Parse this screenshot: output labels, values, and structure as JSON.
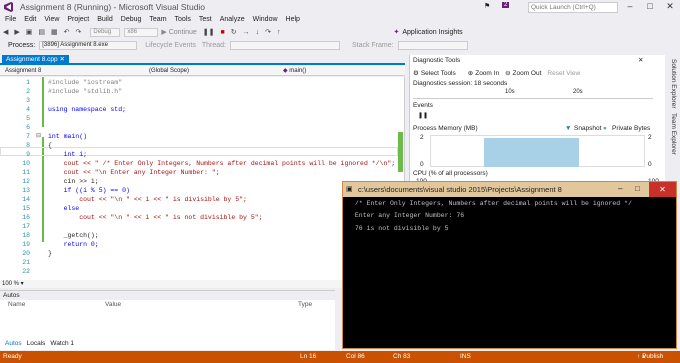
{
  "window": {
    "title": "Assignment 8 (Running) - Microsoft Visual Studio",
    "notif_count": "2",
    "quick_launch": "Quick Launch (Ctrl+Q)"
  },
  "menu": [
    "File",
    "Edit",
    "View",
    "Project",
    "Build",
    "Debug",
    "Team",
    "Tools",
    "Test",
    "Analyze",
    "Window",
    "Help"
  ],
  "toolbar": {
    "config": "Debug",
    "platform": "x86",
    "continue_label": "Continue",
    "application_insights": "Application Insights"
  },
  "procbar": {
    "process_label": "Process:",
    "process_value": "[3896] Assignment 8.exe",
    "lifecycle": "Lifecycle Events",
    "thread": "Thread:",
    "stack": "Stack Frame:"
  },
  "editor": {
    "tab": "Assignment 8.cpp",
    "nav_project": "Assignment 8",
    "nav_scope": "(Global Scope)",
    "nav_func": "main()",
    "zoom": "100 %",
    "lines": [
      {
        "n": "1",
        "t": "#include \"iostream\""
      },
      {
        "n": "2",
        "t": "#include \"stdlib.h\""
      },
      {
        "n": "3",
        "t": ""
      },
      {
        "n": "4",
        "t": "using namespace std;"
      },
      {
        "n": "5",
        "t": ""
      },
      {
        "n": "6",
        "t": ""
      },
      {
        "n": "7",
        "t": "int main()"
      },
      {
        "n": "8",
        "t": "{"
      },
      {
        "n": "9",
        "t": "    int i;"
      },
      {
        "n": "10",
        "t": "    cout << \" /* Enter Only Integers, Numbers after decimal points will be ignored */\\n\";"
      },
      {
        "n": "11",
        "t": "    cout << \"\\n Enter any Integer Number: \";"
      },
      {
        "n": "12",
        "t": "    cin >> i;"
      },
      {
        "n": "13",
        "t": "    if ((i % 5) == 0)"
      },
      {
        "n": "14",
        "t": "        cout << \"\\n \" << i << \" is divisible by 5\";"
      },
      {
        "n": "15",
        "t": "    else"
      },
      {
        "n": "16",
        "t": "        cout << \"\\n \" << i << \" is not divisible by 5\";"
      },
      {
        "n": "17",
        "t": ""
      },
      {
        "n": "18",
        "t": "    _getch();"
      },
      {
        "n": "19",
        "t": "    return 0;"
      },
      {
        "n": "20",
        "t": "}"
      },
      {
        "n": "21",
        "t": ""
      },
      {
        "n": "22",
        "t": ""
      }
    ]
  },
  "autos": {
    "header": "Autos",
    "col_name": "Name",
    "col_value": "Value",
    "col_type": "Type",
    "tabs": [
      "Autos",
      "Locals",
      "Watch 1"
    ]
  },
  "diagnostics": {
    "title": "Diagnostic Tools",
    "select_tools": "Select Tools",
    "zoom_in": "Zoom In",
    "zoom_out": "Zoom Out",
    "reset_view": "Reset View",
    "session": "Diagnostics session: 18 seconds",
    "tick_10": "10s",
    "tick_20": "20s",
    "events": "Events",
    "process_memory": "Process Memory (MB)",
    "snapshot": "Snapshot",
    "private_bytes": "Private Bytes",
    "mem_top": "2",
    "mem_bottom": "0",
    "cpu": "CPU (% of all processors)",
    "cpu_top": "100"
  },
  "side_tabs": [
    "Solution Explorer",
    "Team Explorer"
  ],
  "console": {
    "title": "c:\\users\\documents\\visual studio 2015\\Projects\\Assignment 8",
    "lines": [
      " /* Enter Only Integers, Numbers after decimal points will be ignored */",
      " Enter any Integer Number: 76",
      " 76 is not divisible by 5"
    ]
  },
  "status": {
    "ready": "Ready",
    "ln": "Ln 16",
    "col": "Col 86",
    "ch": "Ch 83",
    "ins": "INS",
    "publish": "Publish"
  },
  "colors": {
    "accent": "#007acc",
    "status_bar": "#ca5100",
    "console_bg": "#000000"
  }
}
